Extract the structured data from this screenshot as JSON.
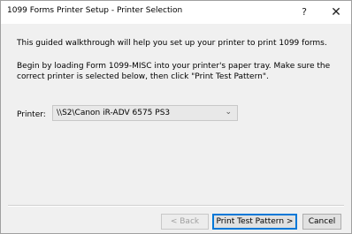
{
  "window": {
    "title": "1099 Forms Printer Setup - Printer Selection",
    "help_glyph": "?",
    "close_glyph": "✕"
  },
  "instructions": {
    "line1": "This guided walkthrough will help you set up your printer to print 1099 forms.",
    "line2": "Begin by loading Form 1099-MISC into your printer's paper tray. Make sure the correct printer is selected below, then click \"Print Test Pattern\"."
  },
  "printer": {
    "label": "Printer:",
    "selected": "\\\\S2\\Canon iR-ADV 6575 PS3",
    "chevron": "⌄"
  },
  "buttons": {
    "back": "< Back",
    "print_test": "Print Test Pattern >",
    "cancel": "Cancel"
  },
  "colors": {
    "accent": "#0078d7",
    "dialog_bg": "#f0f0f0"
  }
}
